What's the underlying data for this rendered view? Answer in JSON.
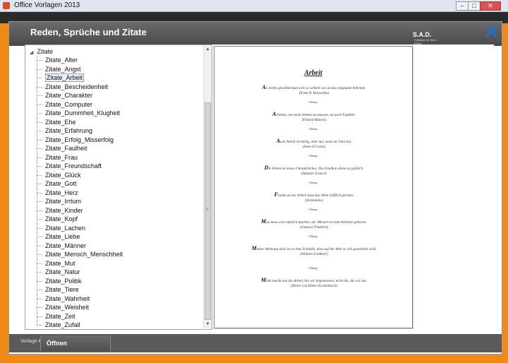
{
  "window": {
    "title": "Office Vorlagen 2013",
    "min_glyph": "–",
    "max_glyph": "□",
    "close_glyph": "✕"
  },
  "dialog": {
    "title": "Reden, Sprüche und Zitate",
    "logo": "S.A.D.",
    "logo_sub": "Software für Ihren Erfolg",
    "close_glyph": "✕"
  },
  "tree": {
    "root": "Zitate",
    "expander_glyph": "◢",
    "selected": "Zitate_Arbeit",
    "items": [
      "Zitate_Alter",
      "Zitate_Angst",
      "Zitate_Arbeit",
      "Zitate_Bescheidenheit",
      "Zitate_Charakter",
      "Zitate_Computer",
      "Zitate_Dummheit_Klugheit",
      "Zitate_Ehe",
      "Zitate_Erfahrung",
      "Zitate_Erfolg_Misserfolg",
      "Zitate_Faulheit",
      "Zitate_Frau",
      "Zitate_Freundschaft",
      "Zitate_Glück",
      "Zitate_Gott",
      "Zitate_Herz",
      "Zitate_Irrtum",
      "Zitate_Kinder",
      "Zitate_Kopf",
      "Zitate_Lachen",
      "Zitate_Liebe",
      "Zitate_Männer",
      "Zitate_Mensch_Menschheit",
      "Zitate_Mut",
      "Zitate_Natur",
      "Zitate_Politik",
      "Zitate_Tiere",
      "Zitate_Wahrheit",
      "Zitate_Weisheit",
      "Zitate_Zeit",
      "Zitate_Zufall"
    ],
    "scroll_up": "▲",
    "scroll_down": "▼",
    "scroll_grip": "≡"
  },
  "preview": {
    "title": "Arbeit",
    "separator": "ᵬᵭᵮᵯᵰᵱ",
    "quotes": [
      {
        "initial": "A",
        "text": "n nichts gewöhnt man sich so schnell wie an das langsame Arbeiten.",
        "author": "(Ernst R. Hauschka)"
      },
      {
        "initial": "A",
        "text": "rbeiten, um nicht denken zu müssen, ist auch Faulheit.",
        "author": "(Erhard Blanck)"
      },
      {
        "initial": "A",
        "text": "uch Arbeit ist heilig, aber nur, wenn sie Sinn hat.",
        "author": "(Sean O'Casey)"
      },
      {
        "initial": "D",
        "text": "ie Arbeit ist etwas Unnatürliches. Die Faulheit allein ist göttlich.",
        "author": "(Anatole France)"
      },
      {
        "initial": "F",
        "text": "reude an der Arbeit lässt das Werk trefflich geraten.",
        "author": "(Aristoteles)"
      },
      {
        "initial": "M",
        "text": "an muss sich nützlich machen, der Mensch ist zum Arbeiten geboren.",
        "author": "(Gustave Flaubert)"
      },
      {
        "initial": "M",
        "text": "einer Meinung nach ist es eine Schande, dass auf der Welt so viel gearbeitet wird.",
        "author": "(William Faulkner)"
      },
      {
        "initial": "M",
        "text": "üde macht uns die Arbeit, die wir liegenlassen, nicht die, die wir tun.",
        "author": "(Marie von Ebner-Eschenbach)"
      }
    ]
  },
  "footer": {
    "label": "Vorlage kata",
    "open_button": "Öffnen"
  }
}
